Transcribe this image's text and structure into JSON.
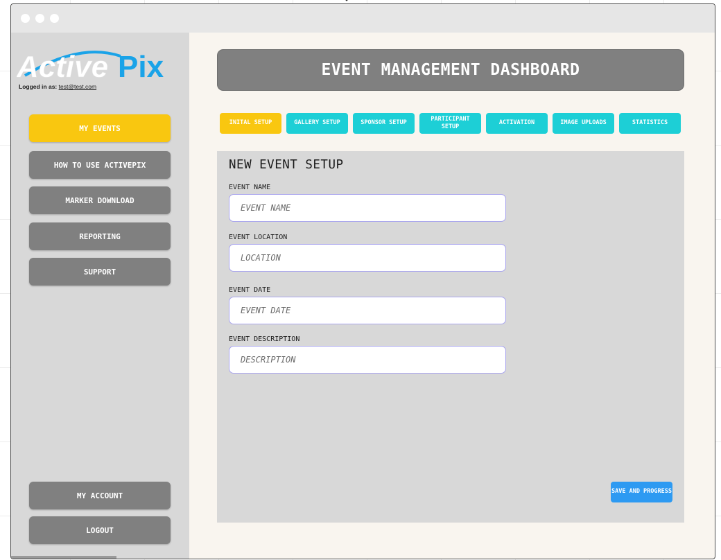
{
  "brand": {
    "logo_text_a": "Active",
    "logo_text_b": "Pix",
    "logged_in_label": "Logged in as:",
    "logged_in_email": "test@test.com"
  },
  "sidebar": {
    "items": [
      {
        "label": "MY EVENTS",
        "active": true
      },
      {
        "label": "HOW TO USE ACTIVEPIX",
        "active": false
      },
      {
        "label": "MARKER DOWNLOAD",
        "active": false
      },
      {
        "label": "REPORTING",
        "active": false
      },
      {
        "label": "SUPPORT",
        "active": false
      }
    ],
    "bottom_items": [
      {
        "label": "MY ACCOUNT"
      },
      {
        "label": "LOGOUT"
      }
    ]
  },
  "header": {
    "title": "EVENT MANAGEMENT DASHBOARD"
  },
  "tabs": [
    {
      "label": "INITAL SETUP",
      "active": true
    },
    {
      "label": "GALLERY SETUP",
      "active": false
    },
    {
      "label": "SPONSOR SETUP",
      "active": false
    },
    {
      "label": "PARTICIPANT SETUP",
      "active": false
    },
    {
      "label": "ACTIVATION",
      "active": false
    },
    {
      "label": "IMAGE UPLOADS",
      "active": false
    },
    {
      "label": "STATISTICS",
      "active": false
    }
  ],
  "form": {
    "title": "NEW EVENT SETUP",
    "fields": [
      {
        "label": "EVENT NAME",
        "placeholder": "EVENT NAME",
        "value": ""
      },
      {
        "label": "EVENT LOCATION",
        "placeholder": "LOCATION",
        "value": ""
      },
      {
        "label": "EVENT DATE",
        "placeholder": "EVENT DATE",
        "value": ""
      },
      {
        "label": "EVENT DESCRIPTION",
        "placeholder": "DESCRIPTION",
        "value": ""
      }
    ],
    "save_label": "SAVE AND PROGRESS"
  },
  "colors": {
    "accent_yellow": "#f9c710",
    "tab_cyan": "#1dcfd6",
    "save_blue": "#2d9af2",
    "button_gray": "#808080",
    "logo_blue": "#1aa3e8"
  }
}
